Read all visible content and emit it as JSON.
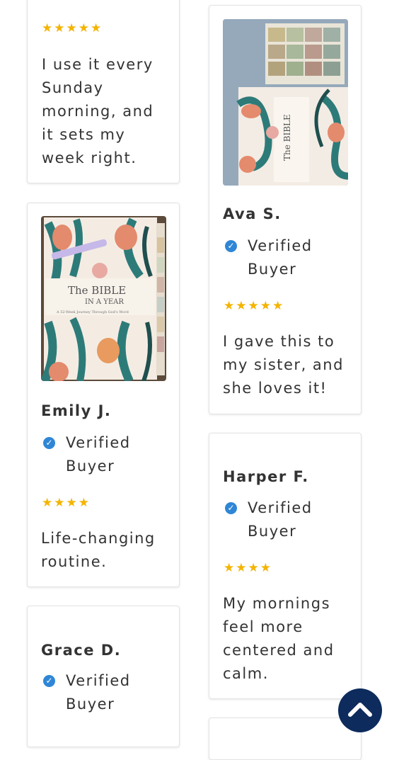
{
  "reviews": {
    "r1": {
      "stars": "★★★★★",
      "text": "I use it every Sunday morning, and it sets my week right."
    },
    "r2": {
      "image_alt": "The Bible in a Year planner with tabs",
      "name": "Ava S.",
      "verified": "Verified Buyer",
      "stars": "★★★★★",
      "text": "I gave this to my sister, and she loves it!"
    },
    "r3": {
      "image_alt": "The Bible in a Year planner",
      "name": "Emily J.",
      "verified": "Verified Buyer",
      "stars": "★★★★",
      "text": "Life-changing routine."
    },
    "r4": {
      "name": "Harper F.",
      "verified": "Verified Buyer",
      "stars": "★★★★",
      "text": "My mornings feel more centered and calm."
    },
    "r5": {
      "name": "Grace D.",
      "verified": "Verified Buyer"
    }
  },
  "book_cover": {
    "title_line1": "The BIBLE",
    "title_line2": "IN A YEAR",
    "subtitle": "A 52-Week Journey Through God's Word"
  },
  "icons": {
    "verified": "check-circle-icon",
    "back_to_top": "chevron-up-icon"
  },
  "colors": {
    "star": "#f4b400",
    "verified": "#2f86d6",
    "back_to_top": "#0d2b5c"
  }
}
